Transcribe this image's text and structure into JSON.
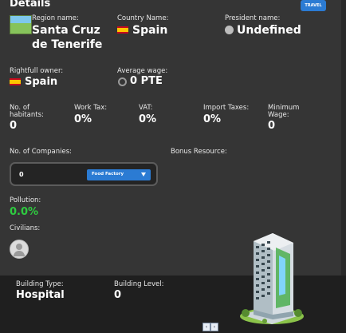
{
  "header": {
    "title": "Details",
    "travel_label": "TRAVEL"
  },
  "region": {
    "label": "Region name:",
    "value_line1": "Santa Cruz",
    "value_line2": "de Tenerife"
  },
  "country": {
    "label": "Country Name:",
    "value": "Spain"
  },
  "president": {
    "label": "President name:",
    "value": "Undefined"
  },
  "owner": {
    "label": "Rightfull owner:",
    "value": "Spain"
  },
  "wage": {
    "label": "Average wage:",
    "value": "0 PTE"
  },
  "stats": {
    "habitants_label_1": "No. of",
    "habitants_label_2": "habitants:",
    "habitants_value": "0",
    "work_tax_label": "Work Tax:",
    "work_tax_value": "0%",
    "vat_label": "VAT:",
    "vat_value": "0%",
    "import_label": "Import Taxes:",
    "import_value": "0%",
    "min_wage_label_1": "Minimum",
    "min_wage_label_2": "Wage:",
    "min_wage_value": "0"
  },
  "companies": {
    "label": "No. of Companies:",
    "value": "0",
    "dropdown_selected": "Food Factory"
  },
  "bonus": {
    "label": "Bonus Resource:"
  },
  "pollution": {
    "label": "Pollution:",
    "value": "0.0%",
    "value_color": "#2ecc40"
  },
  "civilians": {
    "label": "Civilians:"
  },
  "building": {
    "type_label": "Building Type:",
    "type_value": "Hospital",
    "level_label": "Building Level:",
    "level_value": "0"
  },
  "nav": {
    "prev": "‹",
    "next": "›"
  },
  "colors": {
    "accent": "#2b7bd3",
    "panel": "#353535",
    "footer": "#1f1f1f"
  }
}
